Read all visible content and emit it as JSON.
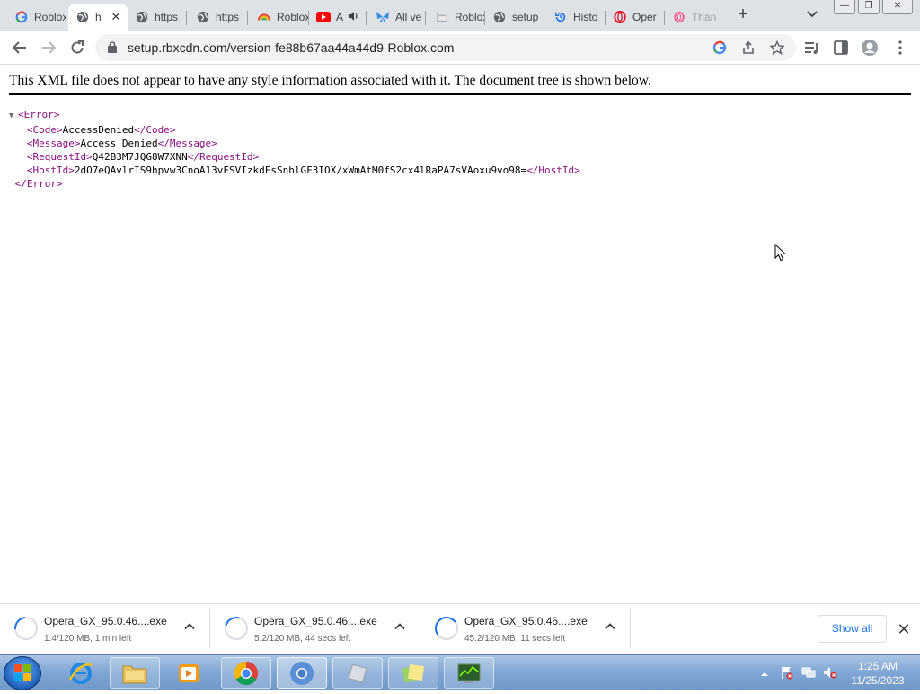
{
  "tabs": [
    {
      "label": "Roblox",
      "icon": "google-icon"
    },
    {
      "label": "h",
      "icon": "globe-icon",
      "active": true
    },
    {
      "label": "https",
      "icon": "globe-icon"
    },
    {
      "label": "https",
      "icon": "globe-icon"
    },
    {
      "label": "Roblox",
      "icon": "rainbow-icon"
    },
    {
      "label": "A",
      "icon": "youtube-icon",
      "audio": true
    },
    {
      "label": "All ve",
      "icon": "butterfly-icon"
    },
    {
      "label": "Roblox",
      "icon": "doc-icon"
    },
    {
      "label": "setup",
      "icon": "globe-icon"
    },
    {
      "label": "Histo",
      "icon": "history-icon"
    },
    {
      "label": "Oper",
      "icon": "opera-icon"
    },
    {
      "label": "Than",
      "icon": "opera-gx-icon"
    }
  ],
  "address_bar": {
    "url": "setup.rbxcdn.com/version-fe88b67aa44a44d9-Roblox.com"
  },
  "xml_viewer": {
    "notice": "This XML file does not appear to have any style information associated with it. The document tree is shown below.",
    "tree": {
      "root_open": "<Error>",
      "code_open": "<Code>",
      "code_value": "AccessDenied",
      "code_close": "</Code>",
      "message_open": "<Message>",
      "message_value": "Access Denied",
      "message_close": "</Message>",
      "requestid_open": "<RequestId>",
      "requestid_value": "Q42B3M7JQG8W7XNN",
      "requestid_close": "</RequestId>",
      "hostid_open": "<HostId>",
      "hostid_value": "2dO7eQAvlrIS9hpvw3CnoA13vFSVIzkdFsSnhlGF3IOX/xWmAtM0fS2cx4lRaPA7sVAoxu9vo98=",
      "hostid_close": "</HostId>",
      "root_close": "</Error>"
    }
  },
  "downloads": [
    {
      "filename": "Opera_GX_95.0.46....exe",
      "status": "1.4/120 MB, 1 min left",
      "progress": 0.012
    },
    {
      "filename": "Opera_GX_95.0.46....exe",
      "status": "5.2/120 MB, 44 secs left",
      "progress": 0.043
    },
    {
      "filename": "Opera_GX_95.0.46....exe",
      "status": "45.2/120 MB, 11 secs left",
      "progress": 0.377
    }
  ],
  "shelf": {
    "show_all_label": "Show all"
  },
  "taskbar": {
    "items": [
      "internet-explorer-icon",
      "file-explorer-icon",
      "media-player-icon",
      "chrome-icon",
      "chrome-icon",
      "roblox-icon",
      "sticky-notes-icon",
      "task-manager-icon"
    ],
    "clock_time": "1:25 AM",
    "clock_date": "11/25/2023"
  },
  "colors": {
    "tag": "#881280",
    "accent": "#1a73e8",
    "tabstrip": "#dee1e6"
  }
}
